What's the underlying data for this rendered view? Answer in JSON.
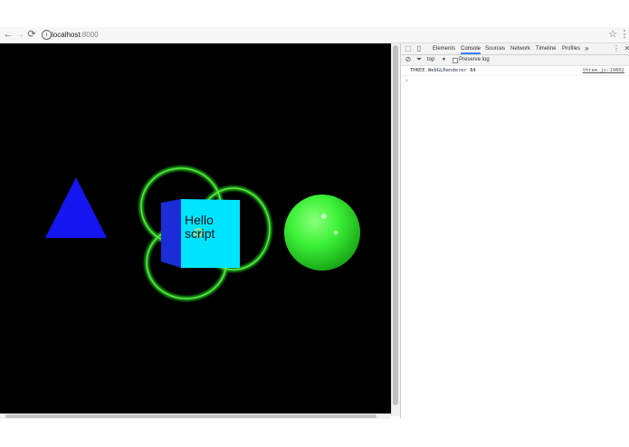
{
  "browser": {
    "address": {
      "host": "localhost",
      "port": ":8000"
    }
  },
  "canvas": {
    "cube_label_line1": "Hello",
    "cube_label_line2": "script",
    "colors": {
      "background": "#000000",
      "cone": "#1515f0",
      "cube_face": "#00e5ff",
      "cube_side": "#1a2dd6",
      "rings": "#22c41f",
      "sphere": "#3cf238"
    }
  },
  "devtools": {
    "tabs": [
      "Elements",
      "Console",
      "Sources",
      "Network",
      "Timeline",
      "Profiles"
    ],
    "more_icon": "»",
    "toolbar": {
      "context": "top",
      "preserve_log": "Preserve log"
    },
    "console": {
      "messages": [
        {
          "text": "THREE.WebGLRenderer 84",
          "source": "three.js:19802"
        }
      ],
      "prompt": "›"
    }
  }
}
